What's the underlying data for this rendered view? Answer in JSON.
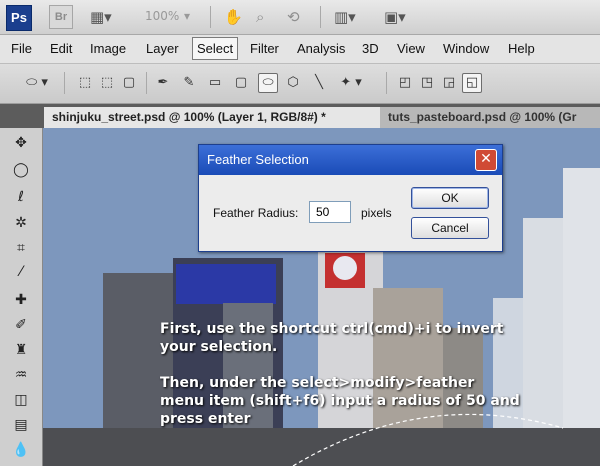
{
  "appbar": {
    "logo": "Ps",
    "bridge_logo": "Br",
    "zoom": "100%",
    "icons": [
      "film-icon",
      "hand-icon",
      "zoom-icon",
      "rotate-icon",
      "arrange-icon",
      "screen-mode-icon"
    ]
  },
  "menubar": {
    "items": [
      "File",
      "Edit",
      "Image",
      "Layer",
      "Select",
      "Filter",
      "Analysis",
      "3D",
      "View",
      "Window",
      "Help"
    ],
    "active": "Select"
  },
  "tabs": [
    {
      "label": "shinjuku_street.psd @ 100% (Layer 1, RGB/8#) *",
      "close": "×"
    },
    {
      "label": "tuts_pasteboard.psd @ 100% (Gr"
    }
  ],
  "dialog": {
    "title": "Feather Selection",
    "label": "Feather Radius:",
    "value": "50",
    "unit": "pixels",
    "ok": "OK",
    "cancel": "Cancel"
  },
  "instructions": [
    "First, use the shortcut ctrl(cmd)+i to invert your selection.",
    "Then, under the select>modify>feather menu item (shift+f6) input a radius of 50 and press enter"
  ]
}
